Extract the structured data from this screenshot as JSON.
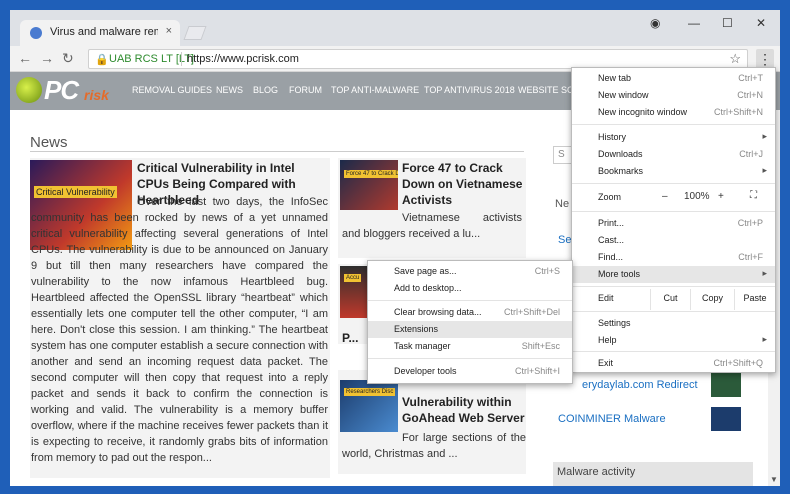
{
  "browser": {
    "tab_title": "Virus and malware remo",
    "tab_close": "×",
    "window_buttons": {
      "profile": "◉",
      "minimize": "—",
      "maximize": "☐",
      "close": "✕"
    },
    "nav": {
      "back": "←",
      "forward": "→",
      "reload": "↻"
    },
    "address": {
      "lock": "🔒",
      "org": "UAB RCS LT [LT]",
      "url": "https://www.pcrisk.com",
      "star": "☆"
    },
    "menu_button": "⋮"
  },
  "site": {
    "logo_pc": "PC",
    "logo_risk": "risk",
    "nav_items": [
      "REMOVAL GUIDES",
      "NEWS",
      "BLOG",
      "FORUM",
      "TOP ANTI-MALWARE",
      "TOP ANTIVIRUS 2018",
      "WEBSITE SCA"
    ]
  },
  "page": {
    "news_heading": "News",
    "articles": [
      {
        "thumb_label": "Critical Vulnerability",
        "title": "Critical Vulnerability in Intel CPUs Being Compared with Heartbleed",
        "body": "Over the last two days, the InfoSec community has been rocked by news of a yet unnamed critical vulnerability affecting several generations of Intel CPUs. The vulnerability is due to be announced on January 9 but till then many researchers have compared the vulnerability to the now infamous Heartbleed bug. Heartbleed affected the OpenSSL library “heartbeat” which essentially lets one computer tell the other computer, “I am here. Don't close this session. I am thinking.” The heartbeat system has one computer establish a secure connection with another and send an incoming request data packet. The second computer will then copy that request into a reply packet and sends it back to confirm the connection is working and valid. The vulnerability is a memory buffer overflow, where if the machine receives fewer packets than it is expecting to receive, it randomly grabs bits of information from memory to pad out the respon..."
      },
      {
        "thumb_label": "Force 47 to Crack Dow",
        "title": "Force 47 to Crack Down on Vietnamese Activists",
        "body": "Vietnamese activists and bloggers received a lu..."
      },
      {
        "thumb_label": "Accu",
        "title": "P...",
        "body": ""
      },
      {
        "thumb_label": "Researchers Disc",
        "title": "Vulnerability within GoAhead Web Server",
        "body": "For large sections of the world, Christmas and ..."
      }
    ],
    "sidebar": {
      "search_placeholder": "S",
      "new_heading": "Ne",
      "link_partial": "Se",
      "link_everyday": "erydaylab.com Redirect",
      "link_coinminer": "COINMINER Malware",
      "malware_activity": "Malware activity"
    }
  },
  "chrome_menu": {
    "items": [
      {
        "label": "New tab",
        "shortcut": "Ctrl+T"
      },
      {
        "label": "New window",
        "shortcut": "Ctrl+N"
      },
      {
        "label": "New incognito window",
        "shortcut": "Ctrl+Shift+N"
      },
      {
        "label": "History",
        "shortcut": ""
      },
      {
        "label": "Downloads",
        "shortcut": "Ctrl+J"
      },
      {
        "label": "Bookmarks",
        "shortcut": ""
      },
      {
        "label": "Print...",
        "shortcut": "Ctrl+P"
      },
      {
        "label": "Cast...",
        "shortcut": ""
      },
      {
        "label": "Find...",
        "shortcut": "Ctrl+F"
      },
      {
        "label": "More tools",
        "shortcut": ""
      },
      {
        "label": "Settings",
        "shortcut": ""
      },
      {
        "label": "Help",
        "shortcut": ""
      },
      {
        "label": "Exit",
        "shortcut": "Ctrl+Shift+Q"
      }
    ],
    "zoom": {
      "label": "Zoom",
      "minus": "–",
      "value": "100%",
      "plus": "+",
      "fullscreen": "⛶"
    },
    "edit": {
      "label": "Edit",
      "cut": "Cut",
      "copy": "Copy",
      "paste": "Paste"
    },
    "submenu_arrow": "▸"
  },
  "more_tools_menu": {
    "items": [
      {
        "label": "Save page as...",
        "shortcut": "Ctrl+S"
      },
      {
        "label": "Add to desktop...",
        "shortcut": ""
      },
      {
        "label": "Clear browsing data...",
        "shortcut": "Ctrl+Shift+Del"
      },
      {
        "label": "Extensions",
        "shortcut": ""
      },
      {
        "label": "Task manager",
        "shortcut": "Shift+Esc"
      },
      {
        "label": "Developer tools",
        "shortcut": "Ctrl+Shift+I"
      }
    ]
  },
  "colors": {
    "frame": "#1f5fb8",
    "highlight": "#e6e6e6",
    "link": "#1a6fc2"
  }
}
